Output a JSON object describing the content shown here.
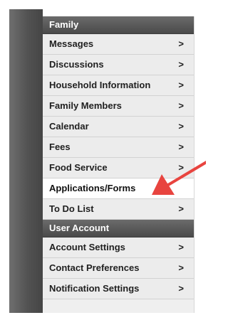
{
  "sections": [
    {
      "header": "Family",
      "items": [
        {
          "label": "Messages",
          "chevron": ">"
        },
        {
          "label": "Discussions",
          "chevron": ">"
        },
        {
          "label": "Household Information",
          "chevron": ">"
        },
        {
          "label": "Family Members",
          "chevron": ">"
        },
        {
          "label": "Calendar",
          "chevron": ">"
        },
        {
          "label": "Fees",
          "chevron": ">"
        },
        {
          "label": "Food Service",
          "chevron": ">"
        },
        {
          "label": "Applications/Forms",
          "chevron": ""
        },
        {
          "label": "To Do List",
          "chevron": ">"
        }
      ]
    },
    {
      "header": "User Account",
      "items": [
        {
          "label": "Account Settings",
          "chevron": ">"
        },
        {
          "label": "Contact Preferences",
          "chevron": ">"
        },
        {
          "label": "Notification Settings",
          "chevron": ">"
        }
      ]
    }
  ],
  "colors": {
    "header_bg": "#555555",
    "item_bg": "#ececec",
    "active_bg": "#ffffff",
    "annotation_arrow": "#e8443f"
  },
  "annotation": {
    "icon": "red-arrow-icon"
  }
}
